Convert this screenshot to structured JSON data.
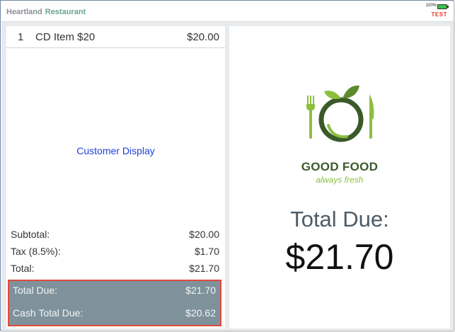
{
  "header": {
    "brand_primary": "Heartland",
    "brand_secondary": "Restaurant",
    "battery": "100%",
    "mode": "TEST"
  },
  "order": {
    "items": [
      {
        "qty": "1",
        "name": "CD Item $20",
        "price": "$20.00"
      }
    ],
    "customer_display_link": "Customer Display",
    "subtotal_label": "Subtotal:",
    "subtotal": "$20.00",
    "tax_label": "Tax (8.5%):",
    "tax": "$1.70",
    "total_label": "Total:",
    "total": "$21.70",
    "total_due_label": "Total Due:",
    "total_due": "$21.70",
    "cash_total_due_label": "Cash Total Due:",
    "cash_total_due": "$20.62"
  },
  "display": {
    "logo_title": "GOOD FOOD",
    "logo_tagline": "always fresh",
    "total_due_label": "Total Due:",
    "total_due_value": "$21.70"
  },
  "colors": {
    "accent_green_dark": "#3b5a2a",
    "accent_green_light": "#8bbf3e",
    "due_panel": "#7f929c",
    "highlight_border": "#e24a3c",
    "link_blue": "#1f3fd6"
  }
}
